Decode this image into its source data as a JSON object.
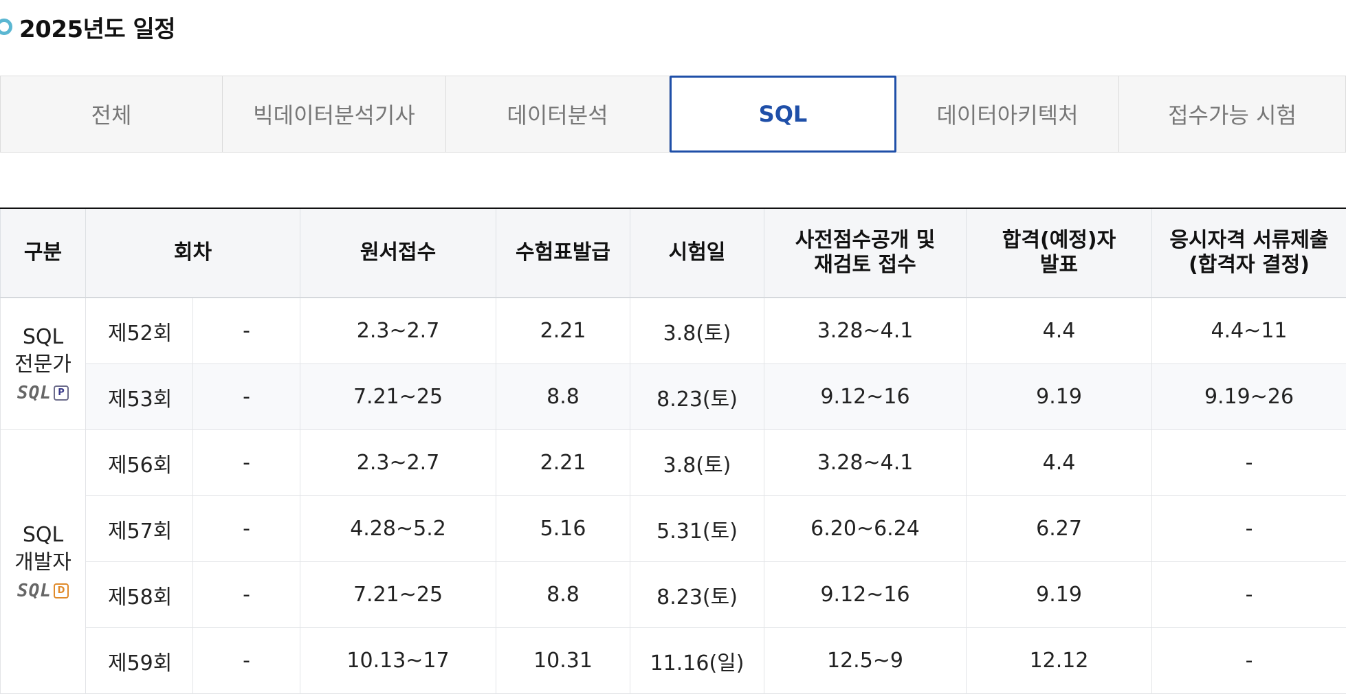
{
  "title": "2025년도 일정",
  "tabs": [
    {
      "label": "전체",
      "active": false
    },
    {
      "label": "빅데이터분석기사",
      "active": false
    },
    {
      "label": "데이터분석",
      "active": false
    },
    {
      "label": "SQL",
      "active": true
    },
    {
      "label": "데이터아키텍처",
      "active": false
    },
    {
      "label": "접수가능 시험",
      "active": false
    }
  ],
  "table": {
    "headers": {
      "category": "구분",
      "round": "회차",
      "application": "원서접수",
      "ticket": "수험표발급",
      "exam_date": "시험일",
      "pre_score_1": "사전점수공개 및",
      "pre_score_2": "재검토 접수",
      "pass_1": "합격(예정)자",
      "pass_2": "발표",
      "docs_1": "응시자격 서류제출",
      "docs_2": "(합격자 결정)"
    },
    "groups": [
      {
        "category_line1": "SQL",
        "category_line2": "전문가",
        "logo_text": "SQL",
        "logo_badge": "P",
        "rows": [
          {
            "round": "제52회",
            "sub": "-",
            "application": "2.3~2.7",
            "ticket": "2.21",
            "exam_date": "3.8(토)",
            "pre_score": "3.28~4.1",
            "pass": "4.4",
            "docs": "4.4~11"
          },
          {
            "round": "제53회",
            "sub": "-",
            "application": "7.21~25",
            "ticket": "8.8",
            "exam_date": "8.23(토)",
            "pre_score": "9.12~16",
            "pass": "9.19",
            "docs": "9.19~26"
          }
        ]
      },
      {
        "category_line1": "SQL",
        "category_line2": "개발자",
        "logo_text": "SQL",
        "logo_badge": "D",
        "rows": [
          {
            "round": "제56회",
            "sub": "-",
            "application": "2.3~2.7",
            "ticket": "2.21",
            "exam_date": "3.8(토)",
            "pre_score": "3.28~4.1",
            "pass": "4.4",
            "docs": "-"
          },
          {
            "round": "제57회",
            "sub": "-",
            "application": "4.28~5.2",
            "ticket": "5.16",
            "exam_date": "5.31(토)",
            "pre_score": "6.20~6.24",
            "pass": "6.27",
            "docs": "-"
          },
          {
            "round": "제58회",
            "sub": "-",
            "application": "7.21~25",
            "ticket": "8.8",
            "exam_date": "8.23(토)",
            "pre_score": "9.12~16",
            "pass": "9.19",
            "docs": "-"
          },
          {
            "round": "제59회",
            "sub": "-",
            "application": "10.13~17",
            "ticket": "10.31",
            "exam_date": "11.16(일)",
            "pre_score": "12.5~9",
            "pass": "12.12",
            "docs": "-"
          }
        ]
      }
    ]
  },
  "colors": {
    "accent": "#1f4fa8",
    "title_dot": "#5bb7d2",
    "header_bg": "#f5f6f8"
  }
}
